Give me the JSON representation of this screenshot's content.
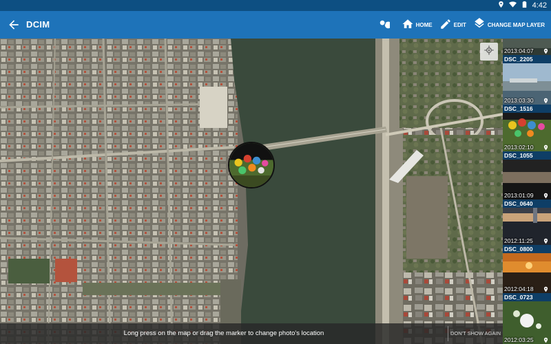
{
  "status": {
    "time": "4:42"
  },
  "toolbar": {
    "title": "DCIM",
    "home_label": "HOME",
    "edit_label": "EDIT",
    "layer_label": "CHANGE MAP LAYER"
  },
  "map": {
    "hint": "Long press on the map or drag the marker to change photo's location",
    "dont_show_label": "DON'T SHOW AGAIN"
  },
  "gallery": {
    "items": [
      {
        "name": "",
        "date": "2013:04:07",
        "selected": false
      },
      {
        "name": "DSC_2205",
        "date": "2013:03:30",
        "selected": false
      },
      {
        "name": "DSC_1516",
        "date": "2013:02:10",
        "selected": true
      },
      {
        "name": "DSC_1055",
        "date": "2013:01:09",
        "selected": false
      },
      {
        "name": "DSC_0640",
        "date": "2012:11:25",
        "selected": false
      },
      {
        "name": "DSC_0800",
        "date": "2012:04:18",
        "selected": false
      },
      {
        "name": "DSC_0723",
        "date": "2012:03:25",
        "selected": false
      }
    ]
  },
  "colors": {
    "status_bar": "#0d4f82",
    "toolbar": "#1e73b9",
    "river": "#3a4a3c",
    "selected_outline": "#f28c28"
  }
}
